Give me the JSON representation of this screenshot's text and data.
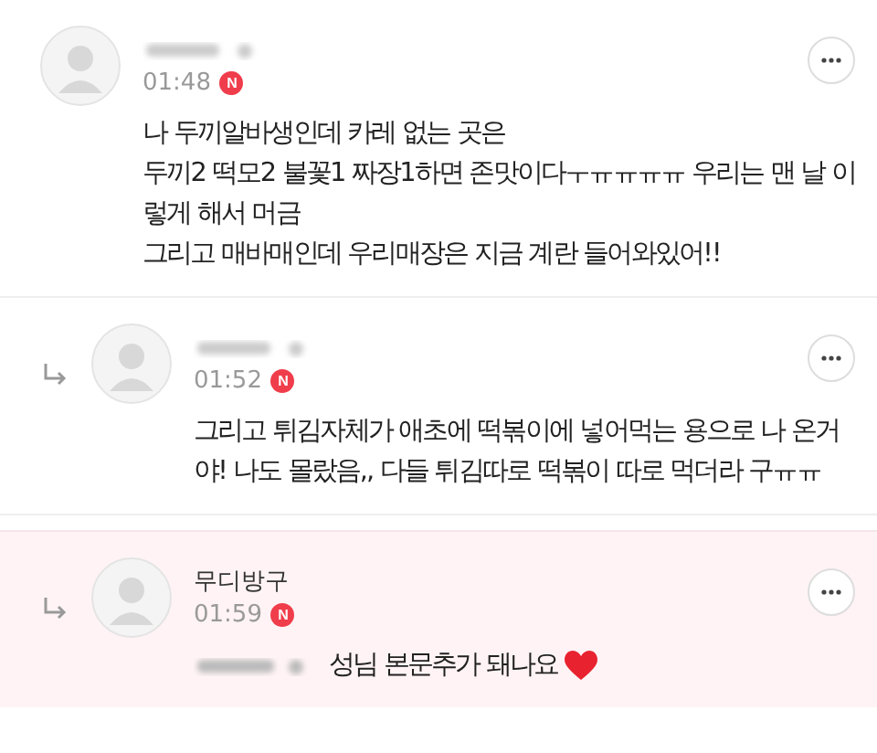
{
  "comments": [
    {
      "kind": "comment",
      "highlighted": false,
      "name_blurred": true,
      "time": "01:48",
      "badge": "N",
      "paragraphs": [
        "나 두끼알바생인데 카레 없는 곳은",
        "두끼2 떡모2 불꽃1 짜장1하면 존맛이다ㅜㅠㅠㅠㅠ 우리는 맨 날 이렇게 해서 머금",
        "그리고 매바매인데 우리매장은 지금 계란 들어와있어!!"
      ]
    },
    {
      "kind": "reply",
      "highlighted": false,
      "name_blurred": true,
      "time": "01:52",
      "badge": "N",
      "paragraphs": [
        "그리고 튀김자체가 애초에 떡볶이에 넣어먹는 용으로 나 온거야! 나도 몰랐음,, 다들 튀김따로 떡볶이 따로 먹더라 구ㅠㅠ"
      ]
    },
    {
      "kind": "reply",
      "highlighted": true,
      "name_blurred": false,
      "author": "무디방구",
      "time": "01:59",
      "badge": "N",
      "mention_blurred": true,
      "heart": true,
      "paragraphs": [
        "성님 본문추가 돼나요"
      ]
    }
  ]
}
